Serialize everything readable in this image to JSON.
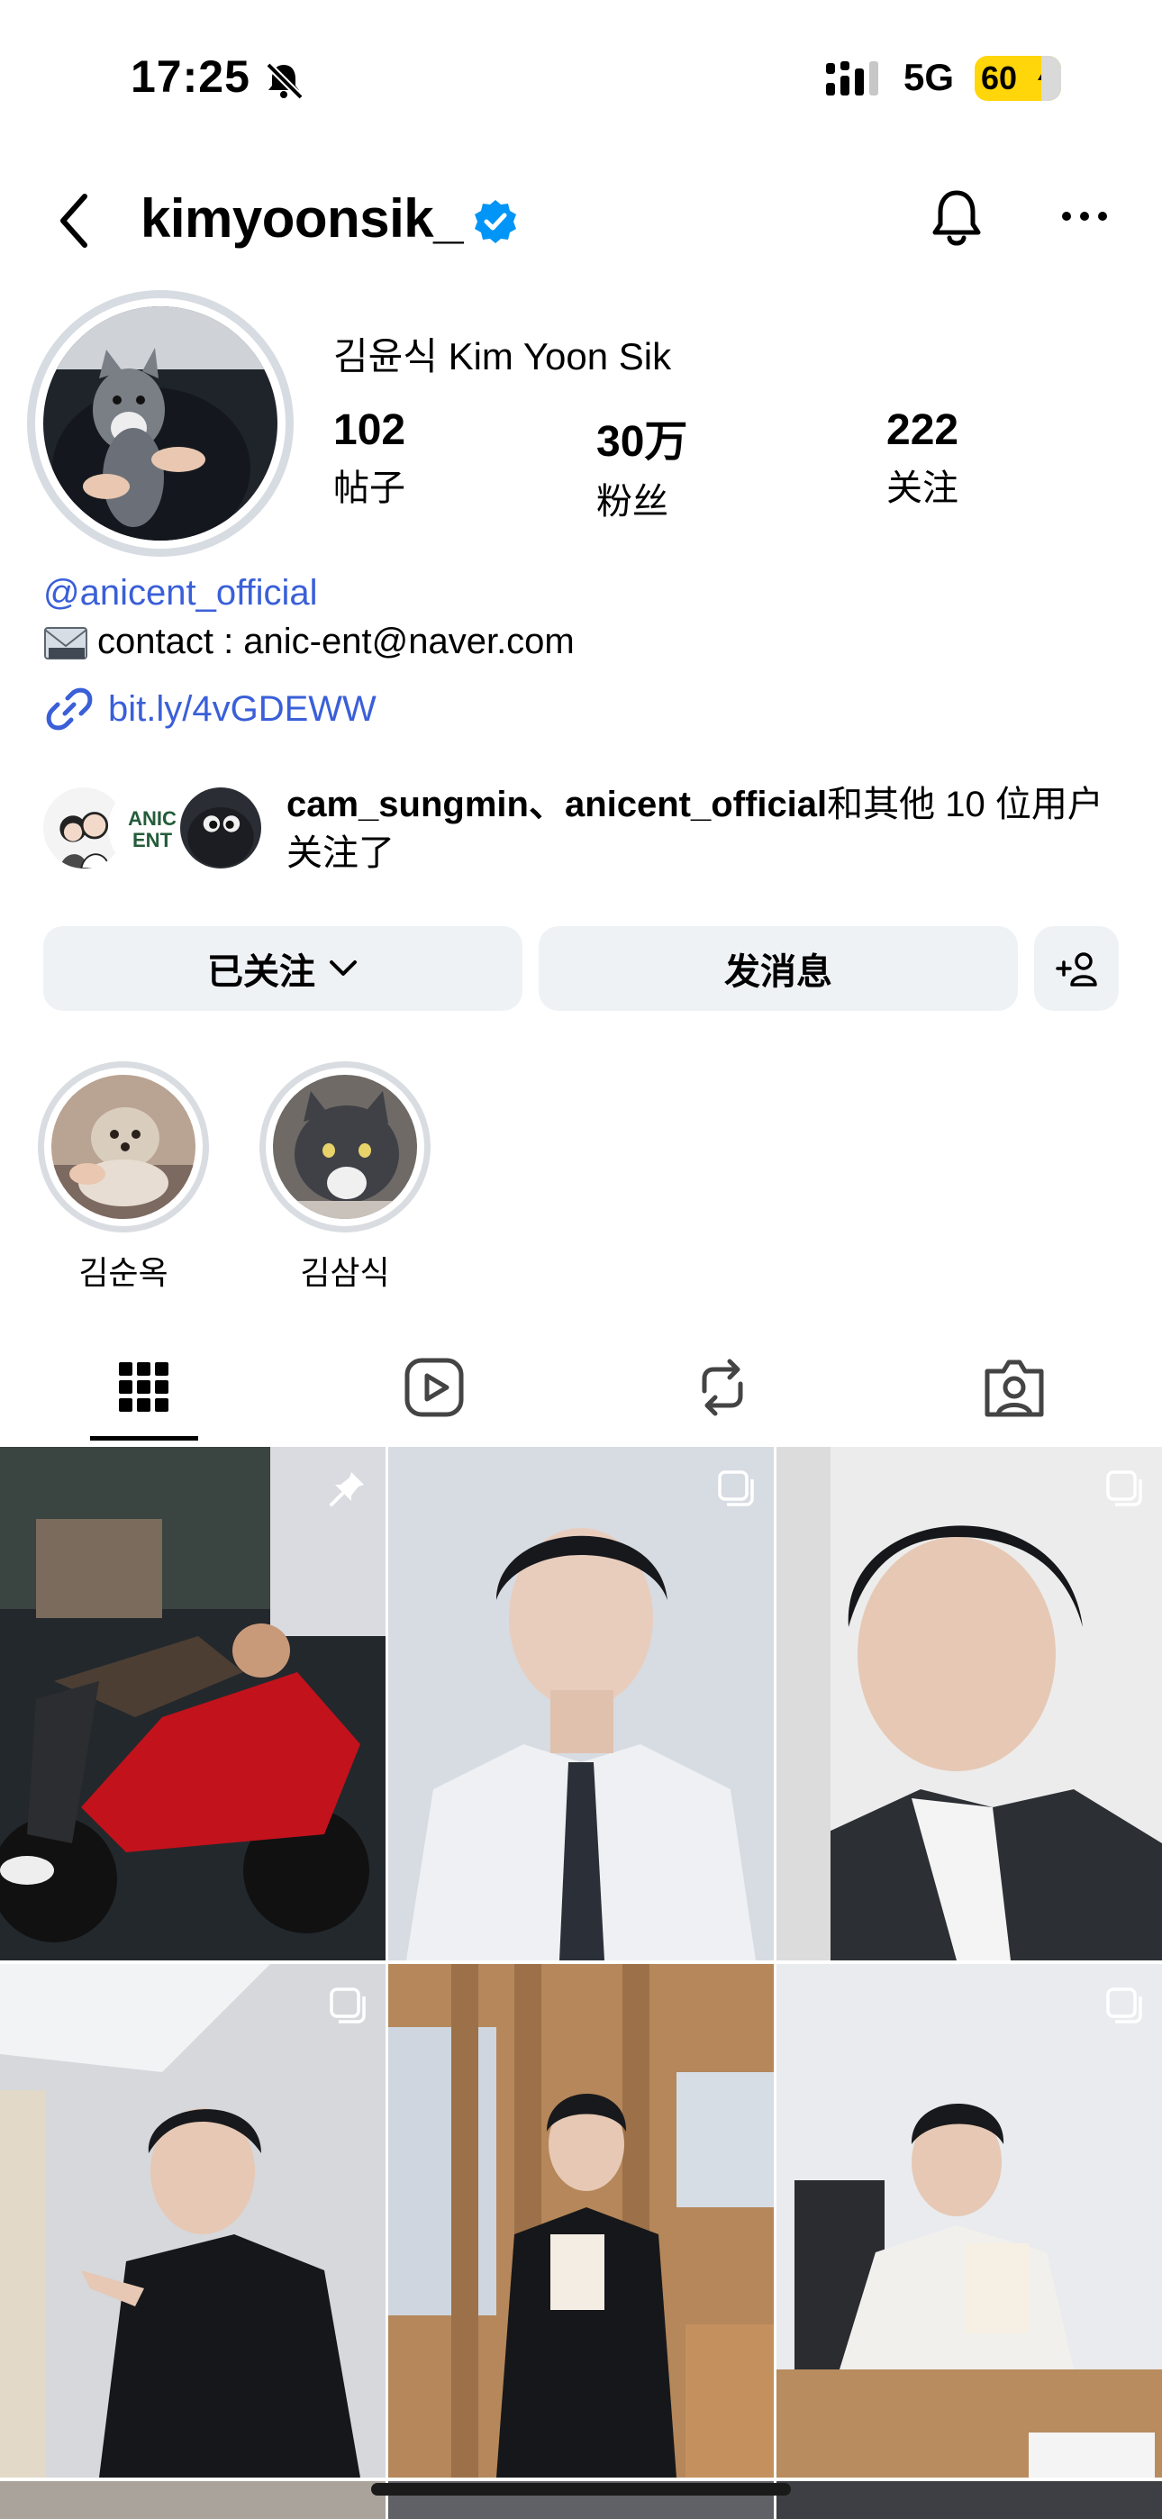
{
  "status_bar": {
    "time": "17:25",
    "network": "5G",
    "battery": "60"
  },
  "header": {
    "username": "kimyoonsik_",
    "verified": true
  },
  "profile": {
    "full_name": "김윤식 Kim Yoon Sik",
    "stats": [
      {
        "value": "102",
        "label": "帖子"
      },
      {
        "value": "30万",
        "label": "粉丝"
      },
      {
        "value": "222",
        "label": "关注"
      }
    ],
    "bio": {
      "mention": "@anicent_official",
      "contact": "contact : anic-ent@naver.com",
      "link": "bit.ly/4vGDEWW"
    },
    "followed_by": {
      "names": "cam_sungmin、anicent_official",
      "rest": "和其他 10 位用户关注了"
    }
  },
  "actions": {
    "following_label": "已关注",
    "message_label": "发消息"
  },
  "highlights": [
    {
      "label": "김순옥"
    },
    {
      "label": "김삼식"
    }
  ],
  "tabs": [
    {
      "name": "posts",
      "icon": "grid-icon",
      "active": true
    },
    {
      "name": "reels",
      "icon": "reels-icon",
      "active": false
    },
    {
      "name": "reposts",
      "icon": "repost-icon",
      "active": false
    },
    {
      "name": "tagged",
      "icon": "tagged-icon",
      "active": false
    }
  ],
  "grid": [
    {
      "badge": "pin-icon"
    },
    {
      "badge": "carousel-icon"
    },
    {
      "badge": "carousel-icon"
    },
    {
      "badge": "carousel-icon"
    },
    {
      "badge": "none"
    },
    {
      "badge": "carousel-icon"
    }
  ],
  "colors": {
    "link": "#3a5fd8",
    "verified": "#0095f6",
    "button_bg": "#eff2f5",
    "battery": "#ffd60a"
  }
}
